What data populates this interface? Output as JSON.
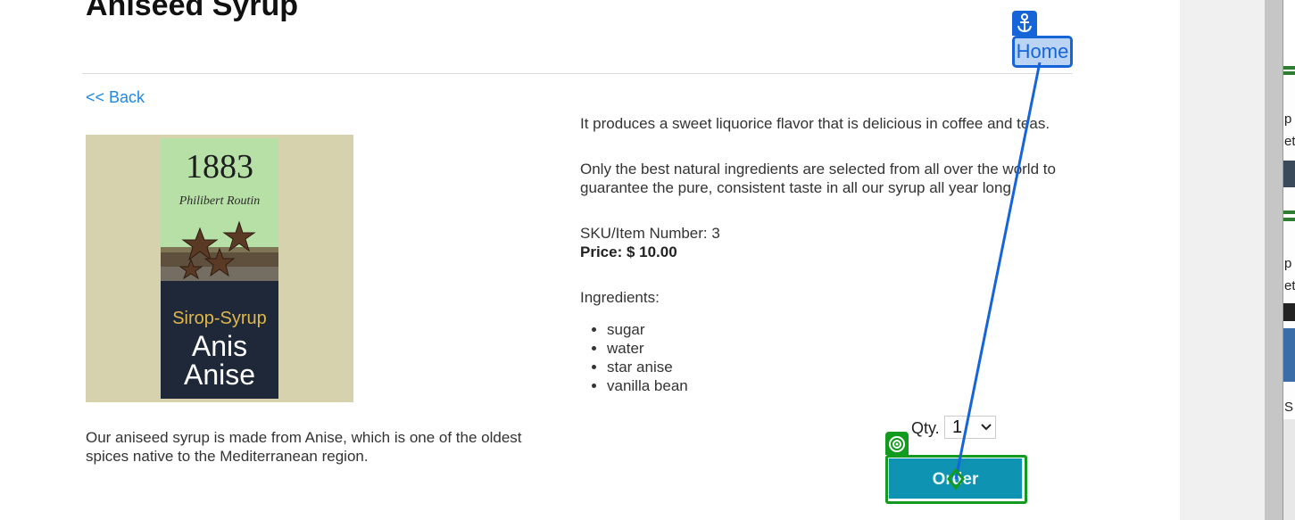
{
  "product": {
    "title": "Aniseed Syrup",
    "image_label_brand": "1883",
    "image_label_maker": "Philibert Routin",
    "image_label_type": "Sirop-Syrup",
    "image_label_name_fr": "Anis",
    "image_label_name_en": "Anise",
    "short_description": "Our aniseed syrup is made from Anise, which is one of the oldest spices native to the Mediterranean region.",
    "paragraph_1": "It produces a sweet liquorice flavor that is delicious in coffee and teas.",
    "paragraph_2": "Only the best natural ingredients are selected from all over the world to guarantee the pure, consistent taste in all our syrup all year long.",
    "sku_line": "SKU/Item Number: 3",
    "price_line": "Price: $ 10.00",
    "ingredients_label": "Ingredients:",
    "ingredients": [
      "sugar",
      "water",
      "star anise",
      "vanilla bean"
    ]
  },
  "nav": {
    "back_label": "<< Back",
    "home_label": "Home"
  },
  "order": {
    "qty_label": "Qty.",
    "qty_value": "1",
    "button_label": "Order"
  },
  "overlay": {
    "anchor_icon": "anchor-icon",
    "target_icon": "target-icon",
    "home_color": "#1565d8",
    "order_color": "#129b1e"
  },
  "edge": {
    "fragments": [
      "p",
      "et",
      "p",
      "et",
      "S"
    ]
  },
  "colors": {
    "link": "#1e88e5",
    "button": "#0e93b3"
  }
}
